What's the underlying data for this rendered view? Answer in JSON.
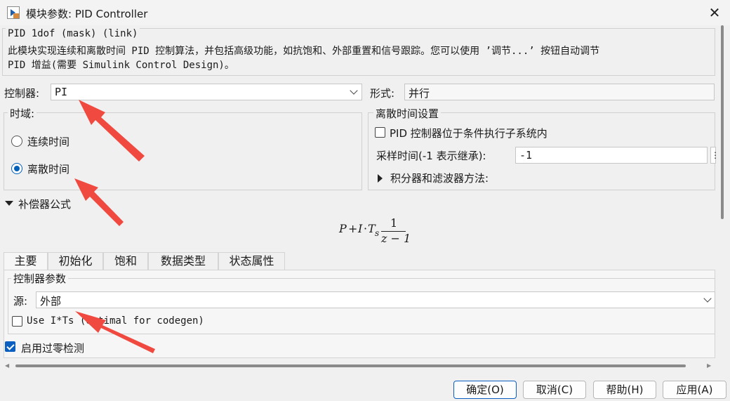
{
  "window": {
    "title": "模块参数: PID Controller",
    "close_label": "✕"
  },
  "mask": {
    "title": "PID 1dof (mask) (link)",
    "description": "此模块实现连续和离散时间 PID 控制算法，并包括高级功能，如抗饱和、外部重置和信号跟踪。您可以使用 ’调节...’ 按钮自动调节\nPID 增益(需要 Simulink Control Design)。"
  },
  "controller": {
    "label": "控制器:",
    "value": "PI"
  },
  "form": {
    "label": "形式:",
    "value": "并行"
  },
  "time_domain": {
    "title": "时域:",
    "options": [
      {
        "label": "连续时间",
        "selected": false
      },
      {
        "label": "离散时间",
        "selected": true
      }
    ]
  },
  "discrete_settings": {
    "title": "离散时间设置",
    "checkbox_label": "PID 控制器位于条件执行子系统内",
    "checkbox_checked": false,
    "sample_time_label": "采样时间(-1 表示继承):",
    "sample_time_value": "-1",
    "integrator_filter_label": "积分器和滤波器方法:"
  },
  "compensator": {
    "label": "补偿器公式",
    "formula": {
      "p": "P",
      "plus": "+",
      "i": "I",
      "dot": "·",
      "ts": "T",
      "ts_sub": "s",
      "num": "1",
      "den": "z − 1"
    }
  },
  "tabs": [
    "主要",
    "初始化",
    "饱和",
    "数据类型",
    "状态属性"
  ],
  "main_tab": {
    "group_title": "控制器参数",
    "source_label": "源:",
    "source_value": "外部",
    "use_its_label": "Use I*Ts (optimal for codegen)",
    "use_its_checked": false
  },
  "zero_crossing": {
    "label": "启用过零检测",
    "checked": true
  },
  "buttons": {
    "ok": "确定(O)",
    "cancel": "取消(C)",
    "help": "帮助(H)",
    "apply": "应用(A)"
  },
  "colors": {
    "accent": "#0a5fc0",
    "annotation_arrow": "#f04a40"
  }
}
